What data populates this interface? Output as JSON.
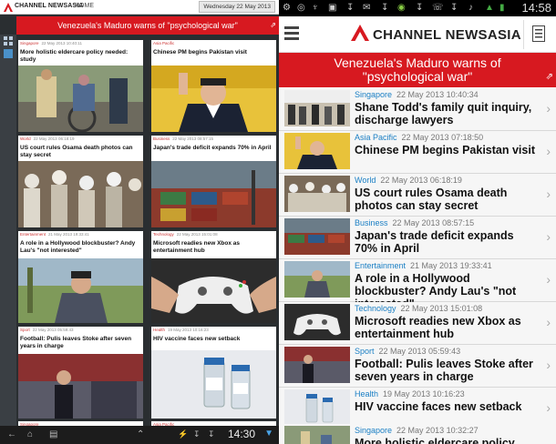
{
  "tablet": {
    "brand": "Channel NewsAsia",
    "home_label": "Home",
    "date": "Wednesday 22 May 2013",
    "banner": "Venezuela's Maduro warns of \"psychological war\"",
    "banner_icon": "external-link-icon",
    "clock": "14:30",
    "cards": [
      {
        "section": "Singapore",
        "timestamp": "22 May 2013 10:40:11",
        "title": "More holistic eldercare policy needed: study"
      },
      {
        "section": "Asia Pacific",
        "timestamp": "",
        "title": "Chinese PM begins Pakistan visit"
      },
      {
        "section": "World",
        "timestamp": "22 May 2013 06:18:19",
        "title": "US court rules Osama death photos can stay secret"
      },
      {
        "section": "Business",
        "timestamp": "22 May 2013 08:57:15",
        "title": "Japan's trade deficit expands 70% in April"
      },
      {
        "section": "Entertainment",
        "timestamp": "21 May 2013 19:33:41",
        "title": "A role in a Hollywood blockbuster? Andy Lau's \"not interested\""
      },
      {
        "section": "Technology",
        "timestamp": "22 May 2013 15:01:08",
        "title": "Microsoft readies new Xbox as entertainment hub"
      },
      {
        "section": "Sport",
        "timestamp": "22 May 2013 05:59:43",
        "title": "Football: Pulis leaves Stoke after seven years in charge"
      },
      {
        "section": "Health",
        "timestamp": "19 May 2013 10:16:23",
        "title": "HIV vaccine faces new setback"
      },
      {
        "section": "Singapore",
        "timestamp": "",
        "title": ""
      },
      {
        "section": "Asia Pacific",
        "timestamp": "",
        "title": ""
      }
    ]
  },
  "phone": {
    "status_time": "14:58",
    "brand": "Channel NewsAsia",
    "banner": "Venezuela's Maduro warns of \"psychological war\"",
    "banner_icon": "external-link-icon",
    "rows": [
      {
        "section": "Singapore",
        "timestamp": "22 May 2013 10:40:34",
        "title": "Shane Todd's family quit inquiry, discharge lawyers"
      },
      {
        "section": "Asia Pacific",
        "timestamp": "22 May 2013 07:18:50",
        "title": "Chinese PM begins Pakistan visit"
      },
      {
        "section": "World",
        "timestamp": "22 May 2013 06:18:19",
        "title": "US court rules Osama death photos can stay secret"
      },
      {
        "section": "Business",
        "timestamp": "22 May 2013 08:57:15",
        "title": "Japan's trade deficit expands 70% in April"
      },
      {
        "section": "Entertainment",
        "timestamp": "21 May 2013 19:33:41",
        "title": "A role in a Hollywood blockbuster? Andy Lau's \"not interested\""
      },
      {
        "section": "Technology",
        "timestamp": "22 May 2013 15:01:08",
        "title": "Microsoft readies new Xbox as entertainment hub"
      },
      {
        "section": "Sport",
        "timestamp": "22 May 2013 05:59:43",
        "title": "Football: Pulis leaves Stoke after seven years in charge"
      },
      {
        "section": "Health",
        "timestamp": "19 May 2013 10:16:23",
        "title": "HIV vaccine faces new setback"
      },
      {
        "section": "Singapore",
        "timestamp": "22 May 2013 10:32:27",
        "title": "More holistic eldercare policy needed:"
      }
    ]
  },
  "colors": {
    "brand_red": "#d71920",
    "section_blue": "#1a7fc4"
  }
}
